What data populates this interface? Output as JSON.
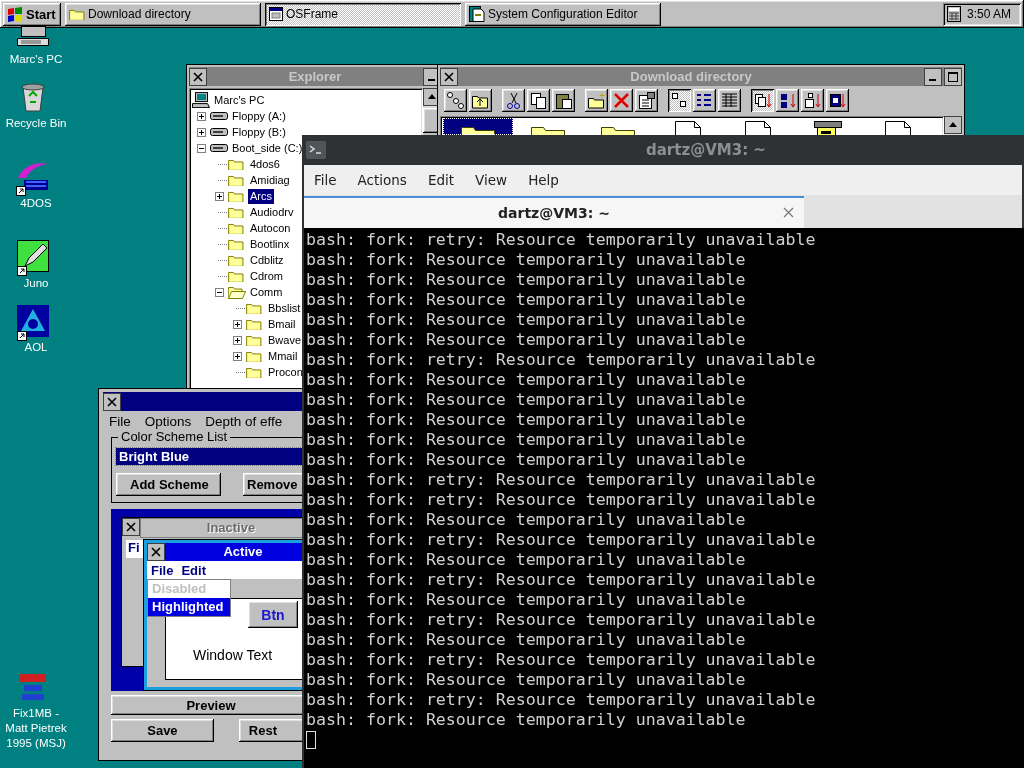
{
  "taskbar": {
    "start_label": "Start",
    "tasks": [
      {
        "label": "Download directory",
        "selected": false
      },
      {
        "label": "OSFrame",
        "selected": true
      },
      {
        "label": "System Configuration Editor",
        "selected": false
      }
    ],
    "clock": "3:50 AM"
  },
  "desktop_icons": [
    {
      "label": "Marc's PC",
      "kind": "computer",
      "shortcut": false
    },
    {
      "label": "Recycle Bin",
      "kind": "recycle",
      "shortcut": false
    },
    {
      "label": "4DOS",
      "kind": "dos",
      "shortcut": true
    },
    {
      "label": "Juno",
      "kind": "pen",
      "shortcut": true
    },
    {
      "label": "AOL",
      "kind": "triangle",
      "shortcut": true
    },
    {
      "label": "Fix1MB - Matt Pietrek 1995 (MSJ)",
      "kind": "badge",
      "shortcut": false
    }
  ],
  "explorer": {
    "title": "Explorer",
    "active": false,
    "tree": [
      {
        "label": "Marc's PC",
        "kind": "computer",
        "selected": false,
        "children": [
          {
            "label": "Floppy (A:)",
            "kind": "drive",
            "expandable": true,
            "expanded": false,
            "selected": false
          },
          {
            "label": "Floppy (B:)",
            "kind": "drive",
            "expandable": true,
            "expanded": false,
            "selected": false
          },
          {
            "label": "Boot_side (C:)",
            "kind": "drive",
            "expandable": true,
            "expanded": true,
            "selected": false,
            "children": [
              {
                "label": "4dos6",
                "kind": "folder",
                "expandable": false,
                "selected": false
              },
              {
                "label": "Amidiag",
                "kind": "folder",
                "expandable": false,
                "selected": false
              },
              {
                "label": "Arcs",
                "kind": "folder",
                "expandable": true,
                "expanded": false,
                "selected": true
              },
              {
                "label": "Audiodrv",
                "kind": "folder",
                "expandable": false,
                "selected": false
              },
              {
                "label": "Autocon",
                "kind": "folder",
                "expandable": false,
                "selected": false
              },
              {
                "label": "Bootlinx",
                "kind": "folder",
                "expandable": false,
                "selected": false
              },
              {
                "label": "Cdblitz",
                "kind": "folder",
                "expandable": false,
                "selected": false
              },
              {
                "label": "Cdrom",
                "kind": "folder",
                "expandable": false,
                "selected": false
              },
              {
                "label": "Comm",
                "kind": "folder",
                "expandable": true,
                "expanded": true,
                "selected": false,
                "children": [
                  {
                    "label": "Bbslist",
                    "kind": "folder",
                    "expandable": false,
                    "selected": false
                  },
                  {
                    "label": "Bmail",
                    "kind": "folder",
                    "expandable": true,
                    "expanded": false,
                    "selected": false
                  },
                  {
                    "label": "Bwave",
                    "kind": "folder",
                    "expandable": true,
                    "expanded": false,
                    "selected": false
                  },
                  {
                    "label": "Mmail",
                    "kind": "folder",
                    "expandable": true,
                    "expanded": false,
                    "selected": false
                  },
                  {
                    "label": "Procon",
                    "kind": "folder",
                    "expandable": false,
                    "selected": false
                  }
                ]
              }
            ]
          }
        ]
      }
    ]
  },
  "download_directory": {
    "title": "Download directory",
    "active": false,
    "toolbar": [
      [
        {
          "pressed": false
        },
        {
          "pressed": false
        }
      ],
      [
        {
          "pressed": false
        },
        {
          "pressed": false
        },
        {
          "pressed": false
        }
      ],
      [
        {
          "pressed": false
        },
        {
          "pressed": false
        },
        {
          "pressed": false
        }
      ],
      [
        {
          "pressed": true
        },
        {
          "pressed": false
        },
        {
          "pressed": false
        }
      ],
      [
        {
          "pressed": true
        },
        {
          "pressed": false
        },
        {
          "pressed": false
        },
        {
          "pressed": false
        }
      ]
    ],
    "files": [
      {
        "kind": "folder",
        "selected": true
      },
      {
        "kind": "folder",
        "selected": false
      },
      {
        "kind": "folder",
        "selected": false
      },
      {
        "kind": "document",
        "selected": false
      },
      {
        "kind": "document",
        "selected": false
      },
      {
        "kind": "cabinet",
        "selected": false
      },
      {
        "kind": "document",
        "selected": false
      }
    ]
  },
  "color_scheme_editor": {
    "active": true,
    "menu": [
      "File",
      "Options",
      "Depth of effe"
    ],
    "group_label": "Color Scheme List",
    "scheme": "Bright Blue",
    "buttons": [
      "Add Scheme",
      "Remove"
    ],
    "preview": {
      "inactive_title": "Inactive",
      "inactive_menu": "Fi",
      "active_title": "Active",
      "active_menu": [
        "File",
        "Edit"
      ],
      "menu_items": [
        {
          "label": "Disabled",
          "disabled": true,
          "selected": false
        },
        {
          "label": "Highlighted",
          "disabled": false,
          "selected": true
        }
      ],
      "button": "Btn",
      "window_text": "Window Text"
    },
    "bottom_buttons": [
      "Preview",
      "Save",
      "Rest"
    ]
  },
  "terminal": {
    "title": "dartz@VM3: ~",
    "menu": [
      "File",
      "Actions",
      "Edit",
      "View",
      "Help"
    ],
    "tabs": [
      {
        "label": "dartz@VM3: ~",
        "selected": true
      }
    ],
    "lines": [
      "bash: fork: retry: Resource temporarily unavailable",
      "bash: fork: Resource temporarily unavailable",
      "bash: fork: Resource temporarily unavailable",
      "bash: fork: Resource temporarily unavailable",
      "bash: fork: Resource temporarily unavailable",
      "bash: fork: Resource temporarily unavailable",
      "bash: fork: retry: Resource temporarily unavailable",
      "bash: fork: Resource temporarily unavailable",
      "bash: fork: Resource temporarily unavailable",
      "bash: fork: Resource temporarily unavailable",
      "bash: fork: Resource temporarily unavailable",
      "bash: fork: Resource temporarily unavailable",
      "bash: fork: retry: Resource temporarily unavailable",
      "bash: fork: retry: Resource temporarily unavailable",
      "bash: fork: Resource temporarily unavailable",
      "bash: fork: retry: Resource temporarily unavailable",
      "bash: fork: Resource temporarily unavailable",
      "bash: fork: retry: Resource temporarily unavailable",
      "bash: fork: Resource temporarily unavailable",
      "bash: fork: retry: Resource temporarily unavailable",
      "bash: fork: Resource temporarily unavailable",
      "bash: fork: retry: Resource temporarily unavailable",
      "bash: fork: Resource temporarily unavailable",
      "bash: fork: retry: Resource temporarily unavailable",
      "bash: fork: Resource temporarily unavailable"
    ],
    "cursor": true
  }
}
